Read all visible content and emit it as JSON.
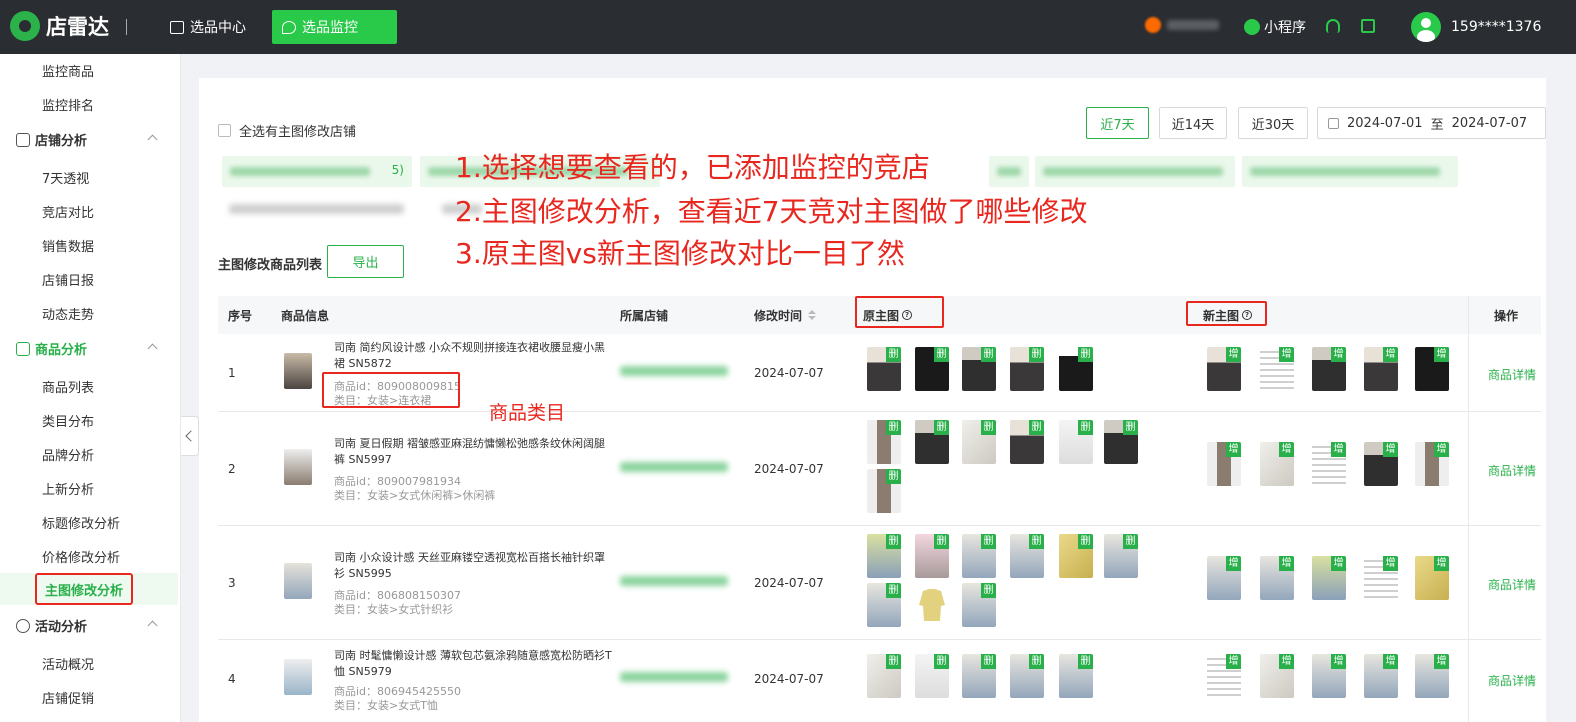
{
  "header": {
    "brand": "店雷达",
    "nav": [
      "选品中心",
      "选品监控"
    ],
    "mini_program": "小程序",
    "user_phone": "159****1376"
  },
  "sidebar": {
    "top_items": [
      "监控商品",
      "监控排名"
    ],
    "groups": [
      {
        "label": "店铺分析",
        "items": [
          "7天透视",
          "竞店对比",
          "销售数据",
          "店铺日报",
          "动态走势"
        ]
      },
      {
        "label": "商品分析",
        "items": [
          "商品列表",
          "类目分布",
          "品牌分析",
          "上新分析",
          "标题修改分析",
          "价格修改分析",
          "主图修改分析"
        ]
      },
      {
        "label": "活动分析",
        "items": [
          "活动概况",
          "店铺促销"
        ]
      }
    ],
    "active_item": "主图修改分析"
  },
  "toolbar": {
    "select_all": "全选有主图修改店铺",
    "date_buttons": [
      "近7天",
      "近14天",
      "近30天"
    ],
    "date_start": "2024-07-01",
    "date_to": "至",
    "date_end": "2024-07-07"
  },
  "store_chips": [
    "5)",
    "..."
  ],
  "list": {
    "title": "主图修改商品列表",
    "export": "导出",
    "columns": [
      "序号",
      "商品信息",
      "所属店铺",
      "修改时间",
      "原主图",
      "新主图",
      "操作"
    ]
  },
  "tag_deleted": "删",
  "tag_added": "增",
  "rows": [
    {
      "no": "1",
      "name": "司南 简约风设计感 小众不规则拼接连衣裙收腰显瘦小黑裙 SN5872",
      "id": "商品id：809008009815",
      "category": "类目：女装>连衣裙",
      "time": "2024-07-07",
      "action": "商品详情"
    },
    {
      "no": "2",
      "name": "司南 夏日假期 褶皱感亚麻混纺慵懒松弛感条纹休闲阔腿裤 SN5997",
      "id": "商品id：809007981934",
      "category": "类目：女装>女式休闲裤>休闲裤",
      "time": "2024-07-07",
      "action": "商品详情"
    },
    {
      "no": "3",
      "name": "司南 小众设计感 天丝亚麻镂空透视宽松百搭长袖针织罩衫 SN5995",
      "id": "商品id：806808150307",
      "category": "类目：女装>女式针织衫",
      "time": "2024-07-07",
      "action": "商品详情"
    },
    {
      "no": "4",
      "name": "司南 时髦慵懒设计感 薄软包芯氨涂鸦随意感宽松防晒衫T恤 SN5979",
      "id": "商品id：806945425550",
      "category": "类目：女装>女式T恤",
      "time": "2024-07-07",
      "action": "商品详情"
    }
  ],
  "annotations": {
    "line1": "1.选择想要查看的，已添加监控的竞店",
    "line2": "2.主图修改分析，查看近7天竞对主图做了哪些修改",
    "line3": "3.原主图vs新主图修改对比一目了然",
    "category_note": "商品类目"
  },
  "colors": {
    "accent": "#29b04a",
    "highlight": "#e8271f",
    "topbar": "#2a2d31"
  }
}
